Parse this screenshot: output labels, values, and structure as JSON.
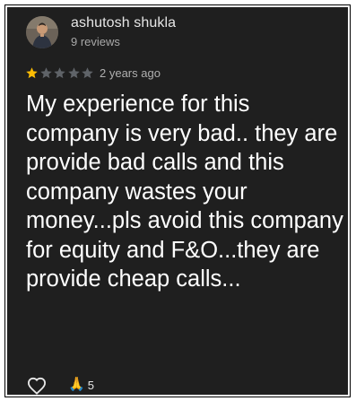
{
  "review": {
    "author": "ashutosh shukla",
    "reviews_count": "9 reviews",
    "rating": 1,
    "rating_max": 5,
    "time": "2 years ago",
    "text": "My experience for this company is very bad.. they are provide bad calls and this company wastes your money...pls avoid this company for equity and F&O...they are provide cheap calls..."
  },
  "actions": {
    "like_icon": "heart-outline-icon",
    "reaction_icon": "folded-hands-emoji",
    "reaction_glyph": "🙏",
    "reaction_count": "5"
  },
  "colors": {
    "background": "#1f1f1f",
    "star_filled": "#fbbc04",
    "star_empty": "#5f6368"
  }
}
